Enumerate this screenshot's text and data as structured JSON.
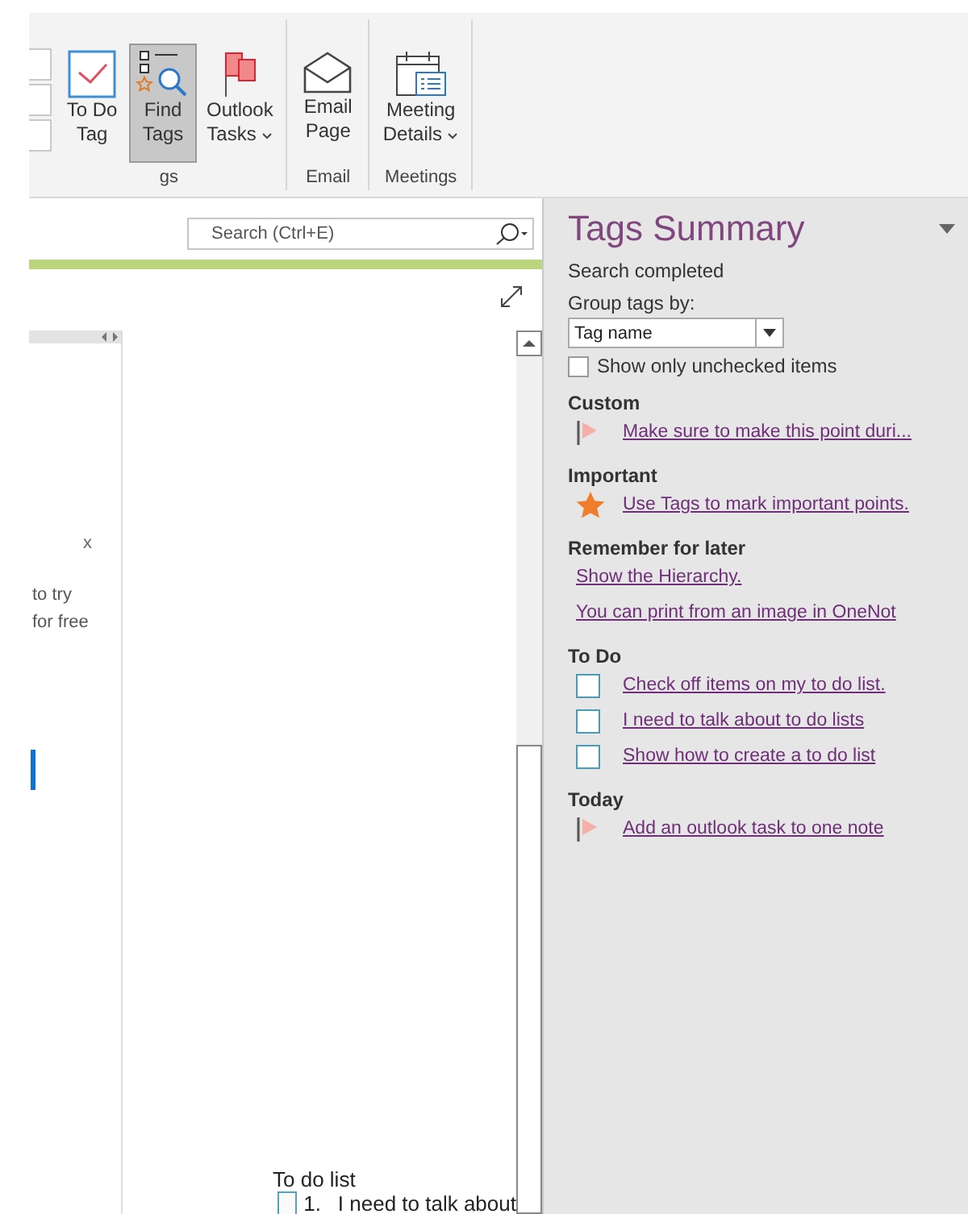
{
  "ribbon": {
    "groups": [
      {
        "label": "gs",
        "buttons": [
          {
            "kind": "todo",
            "lines": [
              "To Do",
              "Tag"
            ],
            "selected": false,
            "dropdown": false
          },
          {
            "kind": "find",
            "lines": [
              "Find",
              "Tags"
            ],
            "selected": true,
            "dropdown": false
          },
          {
            "kind": "outlook",
            "lines": [
              "Outlook",
              "Tasks"
            ],
            "selected": false,
            "dropdown": true
          }
        ]
      },
      {
        "label": "Email",
        "buttons": [
          {
            "kind": "email",
            "lines": [
              "Email",
              "Page"
            ],
            "selected": false,
            "dropdown": false
          }
        ]
      },
      {
        "label": "Meetings",
        "buttons": [
          {
            "kind": "meeting",
            "lines": [
              "Meeting",
              "Details"
            ],
            "selected": false,
            "dropdown": true
          }
        ]
      }
    ]
  },
  "search": {
    "placeholder": "Search (Ctrl+E)"
  },
  "page_list": {
    "close": "x",
    "texts": [
      "to try",
      "for free"
    ]
  },
  "note": {
    "title": "To do list",
    "items": [
      {
        "number": "1.",
        "text": "I need to talk about",
        "checked": false
      }
    ]
  },
  "tags_summary": {
    "title": "Tags Summary",
    "status": "Search completed",
    "group_by_label": "Group tags by:",
    "group_by_value": "Tag name",
    "unchecked_only": {
      "label": "Show only unchecked items",
      "checked": false
    },
    "groups": [
      {
        "name": "Custom",
        "items": [
          {
            "kind": "flag",
            "text": "Make sure to make this point duri..."
          }
        ]
      },
      {
        "name": "Important",
        "items": [
          {
            "kind": "star",
            "text": "Use Tags to mark important points."
          }
        ]
      },
      {
        "name": "Remember for later",
        "items": [
          {
            "kind": "none",
            "text": "Show the Hierarchy."
          },
          {
            "kind": "none",
            "text": "You can print from an image in OneNot"
          }
        ]
      },
      {
        "name": "To Do",
        "items": [
          {
            "kind": "checkbox",
            "checked": false,
            "text": "Check off items on my to do list."
          },
          {
            "kind": "checkbox",
            "checked": false,
            "text": "I need to talk about to do lists"
          },
          {
            "kind": "checkbox",
            "checked": false,
            "text": "Show how to create a to do list"
          }
        ]
      },
      {
        "name": "Today",
        "items": [
          {
            "kind": "flag",
            "text": "Add an outlook task to one note"
          }
        ]
      }
    ]
  }
}
